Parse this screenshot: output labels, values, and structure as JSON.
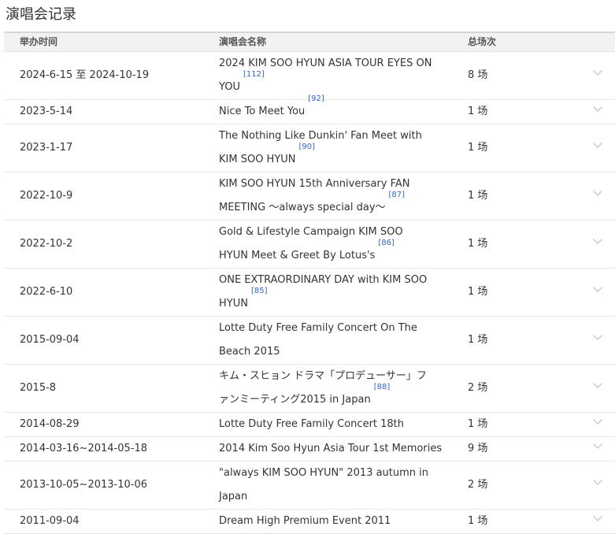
{
  "section_title": "演唱会记录",
  "columns": {
    "date": "举办时间",
    "name": "演唱会名称",
    "count": "总场次"
  },
  "rows": [
    {
      "date": "2024-6-15 至 2024-10-19",
      "name": "2024 KIM SOO HYUN ASIA TOUR EYES ON YOU",
      "ref": "[112]",
      "count": "8 场"
    },
    {
      "date": "2023-5-14",
      "name": "Nice To Meet You",
      "ref": "[92]",
      "count": "1 场"
    },
    {
      "date": "2023-1-17",
      "name": "The Nothing Like Dunkin' Fan Meet with KIM SOO HYUN",
      "ref": "[90]",
      "count": "1 场"
    },
    {
      "date": "2022-10-9",
      "name": "KIM SOO HYUN 15th Anniversary FAN MEETING ～always special day～",
      "ref": "[87]",
      "count": "1 场"
    },
    {
      "date": "2022-10-2",
      "name": "Gold & Lifestyle Campaign KIM SOO HYUN Meet & Greet By Lotus's",
      "ref": "[86]",
      "count": "1 场"
    },
    {
      "date": "2022-6-10",
      "name": "ONE EXTRAORDINARY DAY with KIM SOO HYUN",
      "ref": "[85]",
      "count": "1 场"
    },
    {
      "date": "2015-09-04",
      "name": "Lotte Duty Free Family Concert On The Beach 2015",
      "ref": "",
      "count": "1 场"
    },
    {
      "date": "2015-8",
      "name": "キム・スヒョン ドラマ「プロデューサー」ファンミーティング2015 in Japan",
      "ref": "[88]",
      "count": "2 场"
    },
    {
      "date": "2014-08-29",
      "name": "Lotte Duty Free Family Concert 18th",
      "ref": "",
      "count": "1 场"
    },
    {
      "date": "2014-03-16~2014-05-18",
      "name": "2014 Kim Soo Hyun Asia Tour 1st Memories",
      "ref": "",
      "count": "9 场"
    },
    {
      "date": "2013-10-05~2013-10-06",
      "name": "\"always KIM SOO HYUN\" 2013 autumn in Japan",
      "ref": "",
      "count": "2 场"
    },
    {
      "date": "2011-09-04",
      "name": "Dream High Premium Event 2011",
      "ref": "",
      "count": "1 场"
    }
  ]
}
